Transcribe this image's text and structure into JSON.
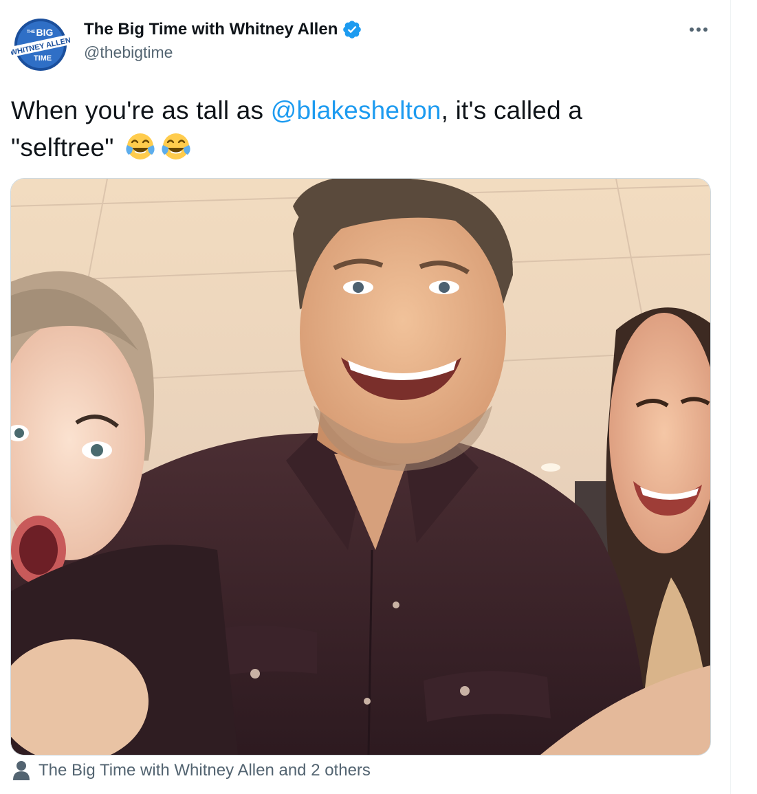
{
  "author": {
    "display_name": "The Big Time with Whitney Allen",
    "handle": "@thebigtime",
    "verified": true,
    "avatar_lines": [
      "THE",
      "BIG",
      "WHITNEY ALLEN",
      "TIME"
    ]
  },
  "tweet": {
    "text_part1": "When you're as tall as ",
    "mention": "@blakeshelton",
    "text_part2": ", it's called a",
    "text_line2": "\"selftree\"",
    "emojis": [
      "face-with-tears-of-joy",
      "face-with-tears-of-joy"
    ]
  },
  "media": {
    "type": "photo",
    "people_count": 3
  },
  "tagged": {
    "label": "The Big Time with Whitney Allen and 2 others"
  },
  "icons": {
    "more": "more-horizontal-icon",
    "verified": "verified-badge-icon",
    "person": "person-icon"
  },
  "colors": {
    "accent": "#1d9bf0",
    "text": "#0f1419",
    "secondary": "#536471",
    "border": "#cfd9de"
  }
}
